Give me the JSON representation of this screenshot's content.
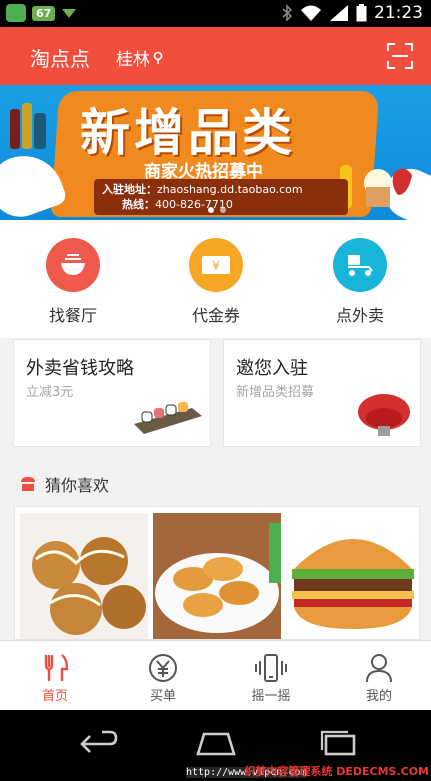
{
  "status_bar": {
    "badge": "67",
    "time": "21:23"
  },
  "header": {
    "app_title": "淘点点",
    "city": "桂林"
  },
  "banner": {
    "title": "新增品类",
    "subtitle": "商家火热招募中",
    "address_label": "入驻地址：",
    "address_value": "zhaoshang.dd.taobao.com",
    "phone_label": "热线：",
    "phone_value": "400-826-7710"
  },
  "categories": [
    {
      "label": "找餐厅",
      "icon": "bowl-icon",
      "color": "#f05a4d"
    },
    {
      "label": "代金券",
      "icon": "voucher-icon",
      "color": "#f5a623"
    },
    {
      "label": "点外卖",
      "icon": "scooter-icon",
      "color": "#19b5d8"
    }
  ],
  "promos": [
    {
      "title": "外卖省钱攻略",
      "subtitle": "立减3元",
      "image": "sushi-plate-image"
    },
    {
      "title": "邀您入驻",
      "subtitle": "新增品类招募",
      "image": "red-armchair-image"
    }
  ],
  "guess": {
    "title": "猜你喜欢",
    "items": [
      {
        "image": "takoyaki-image"
      },
      {
        "image": "fried-nuggets-image"
      },
      {
        "image": "burger-image"
      }
    ]
  },
  "tabbar": {
    "tabs": [
      {
        "label": "首页",
        "icon": "fork-knife-icon",
        "active": true
      },
      {
        "label": "买单",
        "icon": "yuan-circle-icon",
        "active": false
      },
      {
        "label": "摇一摇",
        "icon": "shake-phone-icon",
        "active": false
      },
      {
        "label": "我的",
        "icon": "person-icon",
        "active": false
      }
    ]
  },
  "watermark": {
    "url": "http://www.vipcn.com",
    "brand": "织梦内容管理系统 DEDECMS.COM"
  },
  "colors": {
    "brand_red": "#f24e3d",
    "banner_blue": "#1aa0e6",
    "banner_orange": "#f08a1e"
  }
}
